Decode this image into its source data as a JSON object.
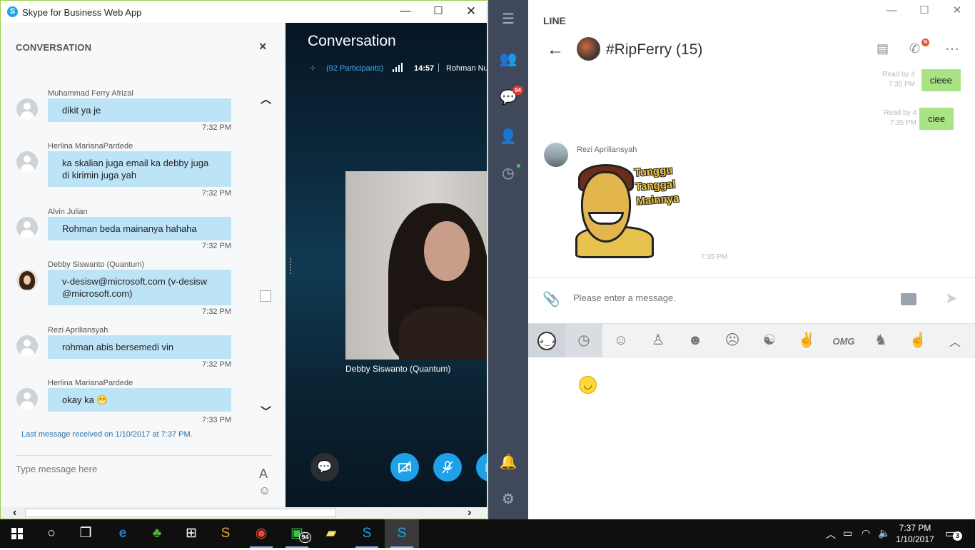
{
  "skype": {
    "window_title": "Skype for Business Web App",
    "pane_title": "CONVERSATION",
    "close_glyph": "×",
    "messages": [
      {
        "sender": "Muhammad Ferry Afrizal",
        "text": "dikit ya je",
        "time": "7:32 PM",
        "avatar": "default"
      },
      {
        "sender": "Herlina MarianaPardede",
        "text": "ka skalian juga email ka debby juga di kirimin juga yah",
        "time": "7:32 PM",
        "avatar": "default"
      },
      {
        "sender": "Alvin Julian",
        "text": "Rohman beda mainanya hahaha",
        "time": "7:32 PM",
        "avatar": "default"
      },
      {
        "sender": "Debby Siswanto (Quantum)",
        "text": "v-desisw@microsoft.com (v-desisw @microsoft.com)",
        "time": "7:32 PM",
        "avatar": "photo"
      },
      {
        "sender": "Rezi Apriliansyah",
        "text": "rohman abis bersemedi vin",
        "time": "7:32 PM",
        "avatar": "default"
      },
      {
        "sender": "Herlina MarianaPardede",
        "text": "okay ka 😁",
        "time": "7:33 PM",
        "avatar": "default"
      }
    ],
    "last_message_status": "Last message received on 1/10/2017 at 7:37 PM.",
    "input_placeholder": "Type message here",
    "font_button": "A",
    "emoji_button": "☺",
    "conversation_title": "Conversation",
    "participants_label": "(92 Participants)",
    "call_duration": "14:57",
    "presenter_name": "Rohman Nu",
    "video_caption": "Debby Siswanto (Quantum)"
  },
  "line": {
    "app_title": "LINE",
    "group_name": "#RipFerry (15)",
    "rail_unread_count": "94",
    "call_badge": "N",
    "own_messages": [
      {
        "read": "Read by 4",
        "time": "7:35 PM",
        "text": "cieee"
      },
      {
        "read": "Read by 4",
        "time": "7:35 PM",
        "text": "ciee"
      }
    ],
    "incoming_sender": "Rezi Apriliansyah",
    "sticker_text": "Tunggu Tanggal Mainnya",
    "sticker_time": "7:35 PM",
    "input_placeholder": "Please enter a message.",
    "sticker_tab_omg": "OMG"
  },
  "taskbar": {
    "line_badge": "94",
    "time": "7:37 PM",
    "date": "1/10/2017",
    "notification_count": "3"
  }
}
